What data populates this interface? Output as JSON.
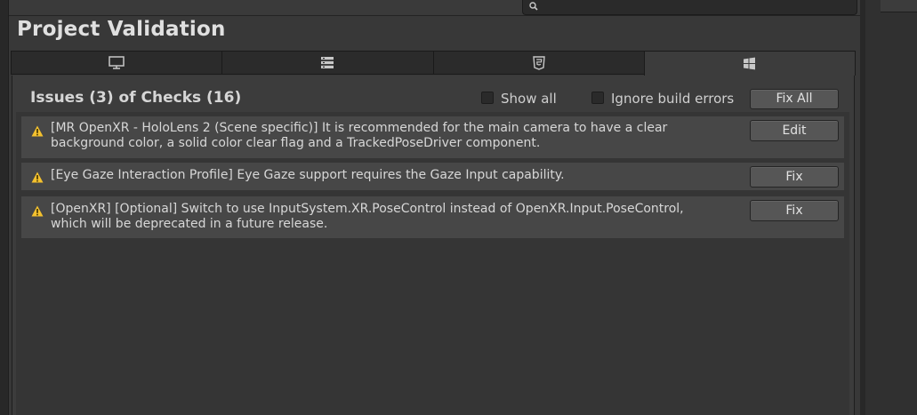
{
  "window": {
    "title": "Project Validation"
  },
  "search": {
    "placeholder": ""
  },
  "tabs": [
    {
      "icon": "monitor-icon"
    },
    {
      "icon": "server-icon"
    },
    {
      "icon": "html5-icon"
    },
    {
      "icon": "windows-icon",
      "selected": true
    }
  ],
  "summary": {
    "title": "Issues (3) of Checks (16)"
  },
  "options": {
    "show_all": {
      "label": "Show all",
      "checked": false
    },
    "ignore_build_errors": {
      "label": "Ignore build errors",
      "checked": false
    },
    "fix_all_label": "Fix All"
  },
  "issues": [
    {
      "icon": "warning-icon",
      "line1": "[MR OpenXR - HoloLens 2 (Scene specific)] It is recommended for the main camera to have a clear",
      "line2": "background color, a solid color clear flag and a TrackedPoseDriver component.",
      "action": "Edit"
    },
    {
      "icon": "warning-icon",
      "line1": "[Eye Gaze Interaction Profile] Eye Gaze support requires the Gaze Input capability.",
      "line2": "",
      "action": "Fix"
    },
    {
      "icon": "warning-icon",
      "line1": "[OpenXR] [Optional] Switch to use InputSystem.XR.PoseControl instead of OpenXR.Input.PoseControl,",
      "line2": "which will be deprecated in a future release.",
      "action": "Fix"
    }
  ],
  "colors": {
    "warning": "#f4c12e",
    "background": "#383838",
    "row": "#474747"
  }
}
